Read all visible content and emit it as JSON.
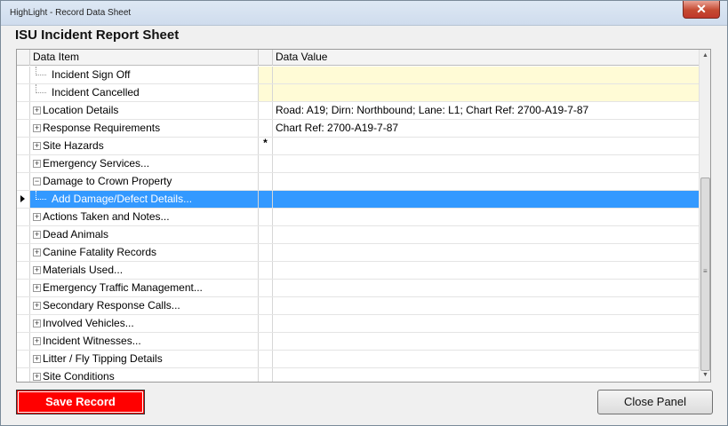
{
  "window": {
    "app_title": "HighLight - Record Data Sheet",
    "close_glyph": "✕"
  },
  "sheet": {
    "title": "ISU Incident Report Sheet"
  },
  "grid": {
    "columns": {
      "item": "Data Item",
      "value": "Data Value"
    },
    "rows": [
      {
        "label": "Incident Sign Off",
        "value": "",
        "type": "child",
        "flag": "",
        "highlight": true
      },
      {
        "label": "Incident Cancelled",
        "value": "",
        "type": "child",
        "flag": "",
        "highlight": true
      },
      {
        "label": "Location Details",
        "value": "Road: A19; Dirn: Northbound; Lane: L1; Chart Ref: 2700-A19-7-87",
        "type": "parent",
        "flag": ""
      },
      {
        "label": "Response Requirements",
        "value": "Chart Ref: 2700-A19-7-87",
        "type": "parent",
        "flag": ""
      },
      {
        "label": "Site Hazards",
        "value": "",
        "type": "parent",
        "flag": "*"
      },
      {
        "label": "Emergency Services...",
        "value": "",
        "type": "parent",
        "flag": ""
      },
      {
        "label": "Damage to Crown Property",
        "value": "",
        "type": "parent-open",
        "flag": ""
      },
      {
        "label": "Add Damage/Defect Details...",
        "value": "",
        "type": "child",
        "flag": "",
        "selected": true
      },
      {
        "label": "Actions Taken and Notes...",
        "value": "",
        "type": "parent",
        "flag": ""
      },
      {
        "label": "Dead Animals",
        "value": "",
        "type": "parent",
        "flag": ""
      },
      {
        "label": "Canine Fatality Records",
        "value": "",
        "type": "parent",
        "flag": ""
      },
      {
        "label": "Materials Used...",
        "value": "",
        "type": "parent",
        "flag": ""
      },
      {
        "label": "Emergency Traffic Management...",
        "value": "",
        "type": "parent",
        "flag": ""
      },
      {
        "label": "Secondary Response Calls...",
        "value": "",
        "type": "parent",
        "flag": ""
      },
      {
        "label": "Involved Vehicles...",
        "value": "",
        "type": "parent",
        "flag": ""
      },
      {
        "label": "Incident Witnesses...",
        "value": "",
        "type": "parent",
        "flag": ""
      },
      {
        "label": "Litter / Fly Tipping Details",
        "value": "",
        "type": "parent",
        "flag": ""
      },
      {
        "label": "Site Conditions",
        "value": "",
        "type": "parent",
        "flag": ""
      }
    ]
  },
  "buttons": {
    "save": "Save Record",
    "close_panel": "Close Panel"
  },
  "colors": {
    "save_button": "#ff0000",
    "selection": "#3399ff",
    "pending_row": "#fffbd6"
  }
}
